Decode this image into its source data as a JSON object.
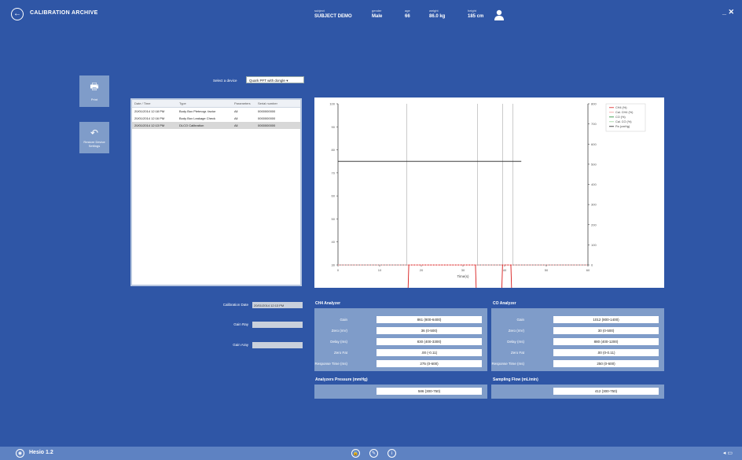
{
  "header": {
    "title": "CALIBRATION ARCHIVE",
    "win_controls": "_ ✕",
    "subject": [
      {
        "label": "subject",
        "value": "SUBJECT DEMO"
      },
      {
        "label": "gender",
        "value": "Male"
      },
      {
        "label": "age",
        "value": "66"
      },
      {
        "label": "weight",
        "value": "86.0 kg"
      },
      {
        "label": "height",
        "value": "185 cm"
      }
    ]
  },
  "side": {
    "print_label": "Print",
    "restore_label": "Restore Device Settings"
  },
  "device": {
    "label": "Select a device",
    "selected": "Quark PFT with dongle ▾"
  },
  "table": {
    "headers": [
      "Date / Time",
      "Type",
      "Parameters",
      "Serial number"
    ],
    "rows": [
      [
        "20/01/2014 12:18 PM",
        "Body Box Pletmogr. factor",
        "All",
        "0000000000"
      ],
      [
        "20/01/2014 12:16 PM",
        "Body Box Leakage Check",
        "All",
        "0000000000"
      ],
      [
        "20/01/2014 12:13 PM",
        "DLCO Calibration",
        "All",
        "0000000000"
      ]
    ]
  },
  "chart_data": {
    "type": "line",
    "xlabel": "Time(s)",
    "xlim": [
      0,
      60
    ],
    "x_ticks": [
      "0",
      "10",
      "20",
      "30",
      "40",
      "50",
      "60"
    ],
    "left_ticks": [
      "100",
      "90",
      "80",
      "70",
      "60",
      "50",
      "40",
      "30"
    ],
    "right_ticks": [
      "800",
      "700",
      "600",
      "500",
      "400",
      "300",
      "200",
      "100",
      "0"
    ],
    "legend": [
      "CH4 (%)",
      "Cal. CH4 (%)",
      "CO (%)",
      "Cal. CO (%)",
      "Pa (cmHg)"
    ],
    "legend_position": "top-right",
    "series": [
      {
        "name": "CH4 (%)",
        "color": "#d81b1b",
        "x": [
          0,
          16.5,
          17,
          20,
          25,
          33,
          33.5,
          39,
          39.5,
          41.5,
          42,
          45
        ],
        "y": [
          0,
          0,
          30,
          30,
          30,
          30,
          0,
          0,
          30,
          30,
          0,
          0
        ]
      },
      {
        "name": "Pa (cmHg)",
        "color": "#222222",
        "x": [
          0,
          44
        ],
        "y": [
          75,
          75
        ]
      },
      {
        "name": "Cal. CH4 (%)",
        "color": "#f19a9a",
        "x": [
          0,
          60
        ],
        "y": [
          30,
          30
        ]
      }
    ],
    "vlines_x": [
      16.5,
      33.5,
      39.5,
      42
    ]
  },
  "calibration": {
    "date_label": "Calibration Date",
    "date_value": "20/01/2014 12:13 PM",
    "gain_ray_label": "Gain Ray",
    "gain_aray_label": "Gain Aray"
  },
  "ch4": {
    "title": "CH4 Analyzer",
    "rows": [
      {
        "k": "Gain",
        "v": "861 (800-6400)"
      },
      {
        "k": "Zero (mV)",
        "v": "36 (0-500)"
      },
      {
        "k": "Delay (ms)",
        "v": "830 (400-3300)"
      },
      {
        "k": "Zero Fat",
        "v": ".00 (-0.11)"
      },
      {
        "k": "Response Time (ms)",
        "v": "275 (0-600)"
      }
    ]
  },
  "co": {
    "title": "CO Analyzer",
    "rows": [
      {
        "k": "Gain",
        "v": "1012 (800-1400)"
      },
      {
        "k": "Zero (mV)",
        "v": "30 (0-500)"
      },
      {
        "k": "Delay (ms)",
        "v": "880 (400-1200)"
      },
      {
        "k": "Zero Fat",
        "v": ".00 (0-0.11)"
      },
      {
        "k": "Response Time (ms)",
        "v": "250 (0-600)"
      }
    ]
  },
  "pressure": {
    "title": "Analyzers Pressure (mmHg)",
    "value": "586 (300-750)"
  },
  "flow": {
    "title": "Sampling Flow (mL/min)",
    "value": "412 (300-750)"
  },
  "footer": {
    "title": "Hesio 1.2",
    "right": "◂ ▭"
  }
}
